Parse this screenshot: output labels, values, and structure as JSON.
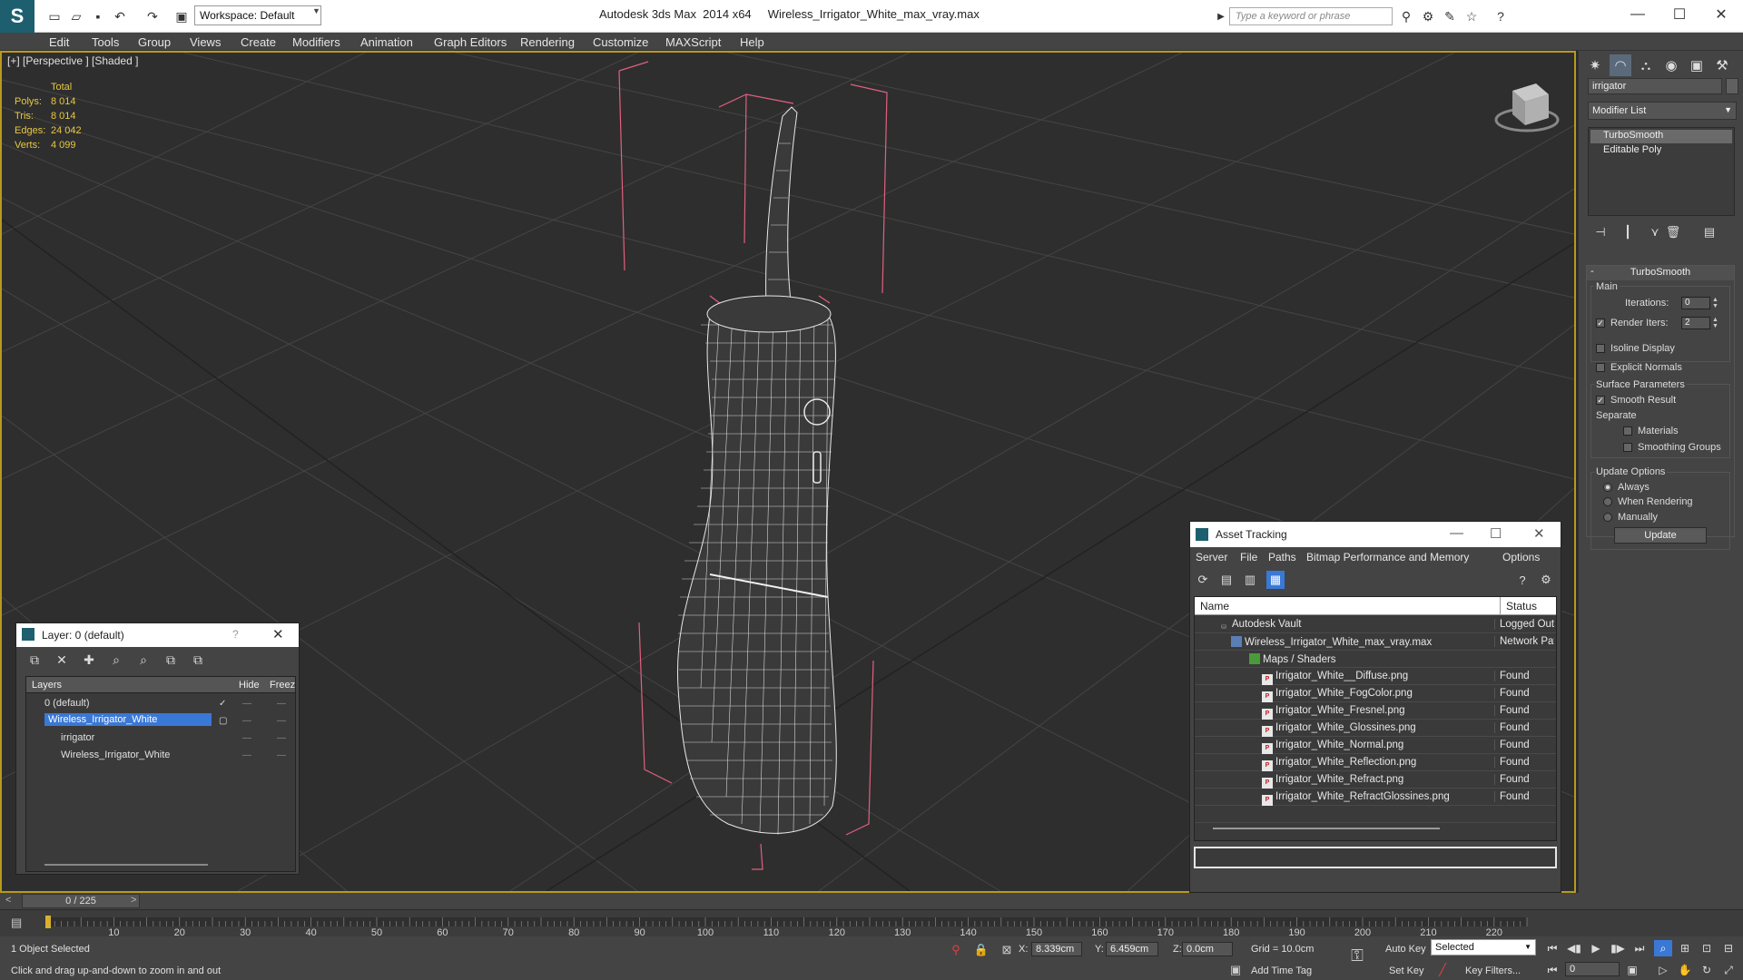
{
  "titlebar": {
    "app_title": "Autodesk 3ds Max  2014 x64     Wireless_Irrigator_White_max_vray.max",
    "workspace": "Workspace: Default",
    "search_placeholder": "Type a keyword or phrase"
  },
  "menus": [
    "Edit",
    "Tools",
    "Group",
    "Views",
    "Create",
    "Modifiers",
    "Animation",
    "Graph Editors",
    "Rendering",
    "Customize",
    "MAXScript",
    "Help"
  ],
  "viewport": {
    "label": "[+] [Perspective ] [Shaded ]",
    "stats": {
      "header": "Total",
      "rows": [
        {
          "k": "Polys:",
          "v": "8 014"
        },
        {
          "k": "Tris:",
          "v": "8 014"
        },
        {
          "k": "Edges:",
          "v": "24 042"
        },
        {
          "k": "Verts:",
          "v": "4 099"
        }
      ]
    },
    "colors": {
      "grid": "#4a4a4a",
      "wire": "#e8e8e8",
      "bbox": "#e06080",
      "border": "#b89a1c"
    }
  },
  "command_panel": {
    "object_name": "irrigator",
    "modifier_list": "Modifier List",
    "stack": [
      "TurboSmooth",
      "Editable Poly"
    ],
    "rollout_title": "TurboSmooth",
    "main_label": "Main",
    "iterations_label": "Iterations:",
    "iterations_value": "0",
    "render_iters_label": "Render Iters:",
    "render_iters_value": "2",
    "isoline": "Isoline Display",
    "explicit_normals": "Explicit Normals",
    "surface_params": "Surface Parameters",
    "smooth_result": "Smooth Result",
    "separate": "Separate",
    "materials": "Materials",
    "smoothing_groups": "Smoothing Groups",
    "update_options": "Update Options",
    "always": "Always",
    "when_rendering": "When Rendering",
    "manually": "Manually",
    "update_btn": "Update"
  },
  "layer_window": {
    "title": "Layer: 0 (default)",
    "help": "?",
    "columns": {
      "layers": "Layers",
      "hide": "Hide",
      "freeze": "Freez"
    },
    "rows": [
      {
        "name": "0 (default)"
      },
      {
        "name": "Wireless_Irrigator_White"
      },
      {
        "name": "irrigator"
      },
      {
        "name": "Wireless_Irrigator_White"
      }
    ]
  },
  "asset_window": {
    "title": "Asset Tracking",
    "menu": [
      "Server",
      "File",
      "Paths",
      "Bitmap Performance and Memory",
      "Options"
    ],
    "columns": {
      "name": "Name",
      "status": "Status"
    },
    "rows": [
      {
        "name": "Autodesk Vault",
        "status": "Logged Out ...",
        "icon": "vault"
      },
      {
        "name": "Wireless_Irrigator_White_max_vray.max",
        "status": "Network Path",
        "icon": "file"
      },
      {
        "name": "Maps / Shaders",
        "status": "",
        "icon": "folder"
      },
      {
        "name": "Irrigator_White__Diffuse.png",
        "status": "Found",
        "icon": "png"
      },
      {
        "name": "Irrigator_White_FogColor.png",
        "status": "Found",
        "icon": "png"
      },
      {
        "name": "Irrigator_White_Fresnel.png",
        "status": "Found",
        "icon": "png"
      },
      {
        "name": "Irrigator_White_Glossines.png",
        "status": "Found",
        "icon": "png"
      },
      {
        "name": "Irrigator_White_Normal.png",
        "status": "Found",
        "icon": "png"
      },
      {
        "name": "Irrigator_White_Reflection.png",
        "status": "Found",
        "icon": "png"
      },
      {
        "name": "Irrigator_White_Refract.png",
        "status": "Found",
        "icon": "png"
      },
      {
        "name": "Irrigator_White_RefractGlossines.png",
        "status": "Found",
        "icon": "png"
      }
    ]
  },
  "timeline": {
    "frame": "0 / 225",
    "prev": "<",
    "next": ">",
    "ticks": [
      "10",
      "20",
      "30",
      "40",
      "50",
      "60",
      "70",
      "80",
      "90",
      "100",
      "110",
      "120",
      "130",
      "140",
      "150",
      "160",
      "170",
      "180",
      "190",
      "200",
      "210",
      "220"
    ]
  },
  "status": {
    "selected": "1 Object Selected",
    "prompt": "Click and drag up-and-down to zoom in and out",
    "x_label": "X:",
    "x_value": "8.339cm",
    "y_label": "Y:",
    "y_value": "6.459cm",
    "z_label": "Z:",
    "z_value": "0.0cm",
    "grid": "Grid = 10.0cm",
    "add_time_tag": "Add Time Tag",
    "auto_key": "Auto Key",
    "set_key": "Set Key",
    "key_mode": "Selected",
    "key_filters": "Key Filters...",
    "frame_field": "0"
  }
}
